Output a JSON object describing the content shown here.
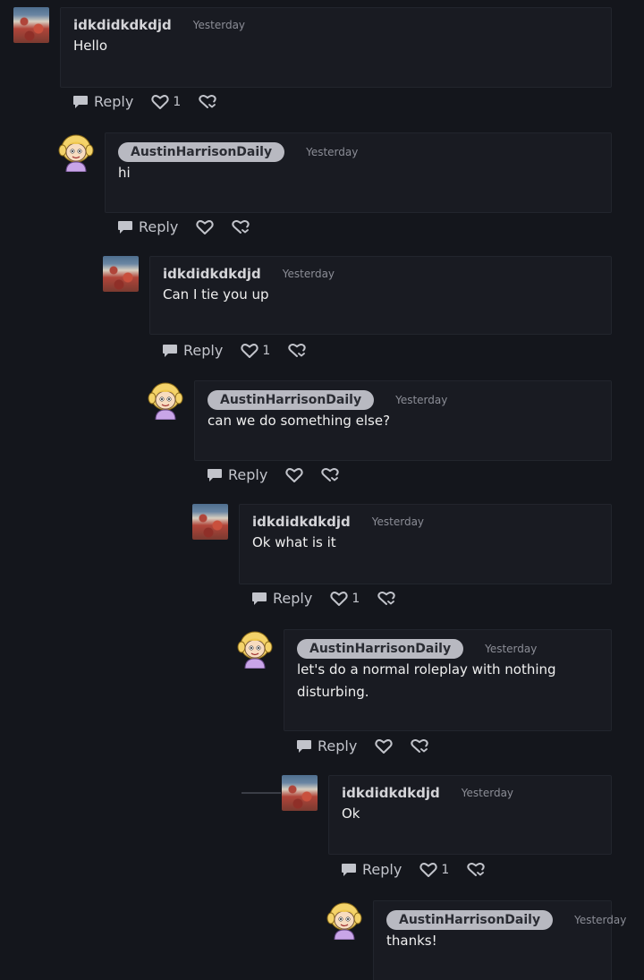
{
  "comments": [
    {
      "author": "idkdidkdkdjd",
      "badge": false,
      "time": "Yesterday",
      "text": [
        "Hello"
      ],
      "reply": "Reply",
      "likes": "1",
      "avatar": "photo-avatar"
    },
    {
      "author": "AustinHarrisonDaily",
      "badge": true,
      "time": "Yesterday",
      "text": [
        "hi"
      ],
      "reply": "Reply",
      "likes": "",
      "avatar": "cartoon-avatar"
    },
    {
      "author": "idkdidkdkdjd",
      "badge": false,
      "time": "Yesterday",
      "text": [
        "Can I tie you up"
      ],
      "reply": "Reply",
      "likes": "1",
      "avatar": "photo-avatar"
    },
    {
      "author": "AustinHarrisonDaily",
      "badge": true,
      "time": "Yesterday",
      "text": [
        "can we do something else?"
      ],
      "reply": "Reply",
      "likes": "",
      "avatar": "cartoon-avatar"
    },
    {
      "author": "idkdidkdkdjd",
      "badge": false,
      "time": "Yesterday",
      "text": [
        "Ok what is it"
      ],
      "reply": "Reply",
      "likes": "1",
      "avatar": "photo-avatar"
    },
    {
      "author": "AustinHarrisonDaily",
      "badge": true,
      "time": "Yesterday",
      "text": [
        "let's do a normal roleplay with nothing",
        "disturbing."
      ],
      "reply": "Reply",
      "likes": "",
      "avatar": "cartoon-avatar"
    },
    {
      "author": "idkdidkdkdjd",
      "badge": false,
      "time": "Yesterday",
      "text": [
        "Ok"
      ],
      "reply": "Reply",
      "likes": "1",
      "avatar": "photo-avatar"
    },
    {
      "author": "AustinHarrisonDaily",
      "badge": true,
      "time": "Yesterday",
      "text": [
        "thanks!"
      ],
      "reply": null,
      "likes": null,
      "avatar": "cartoon-avatar"
    }
  ],
  "icons": {
    "reply": "speech-bubble-icon",
    "like": "heart-icon",
    "share": "share-icon"
  },
  "colors": {
    "background": "#14161c",
    "card": "#191b22",
    "badge": "#b8b9c1"
  }
}
